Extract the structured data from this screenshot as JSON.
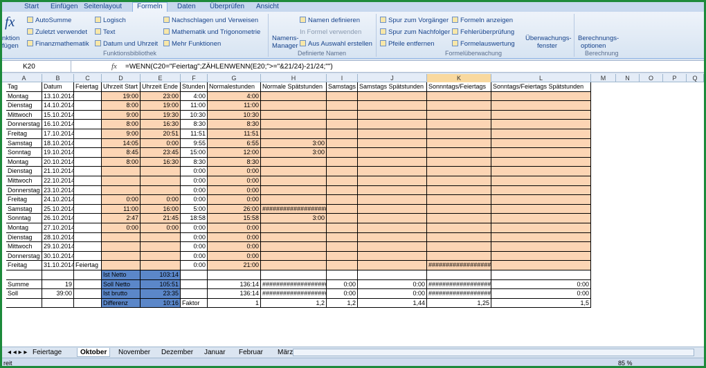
{
  "tabs": [
    "Start",
    "Einfügen",
    "Seitenlayout",
    "Formeln",
    "Daten",
    "Überprüfen",
    "Ansicht"
  ],
  "ribbon": {
    "fx_btn": "fx",
    "fx_label1": "nktion",
    "fx_label2": "fügen",
    "autosum": "AutoSumme",
    "recent": "Zuletzt verwendet",
    "finance": "Finanzmathematik",
    "logic": "Logisch",
    "text": "Text",
    "datetime": "Datum und Uhrzeit",
    "lookup": "Nachschlagen und Verweisen",
    "math": "Mathematik und Trigonometrie",
    "more": "Mehr Funktionen",
    "group1": "Funktionsbibliothek",
    "names_mgr": "Namens-",
    "names_mgr2": "Manager",
    "define": "Namen definieren",
    "in_formula": "In Formel verwenden",
    "from_sel": "Aus Auswahl erstellen",
    "group2": "Definierte Namen",
    "trace_prec": "Spur zum Vorgänger",
    "trace_dep": "Spur zum Nachfolger",
    "remove_arrows": "Pfeile entfernen",
    "show_formulas": "Formeln anzeigen",
    "error_check": "Fehlerüberprüfung",
    "evaluate": "Formelauswertung",
    "group3": "Formelüberwachung",
    "watch1": "Überwachungs-",
    "watch2": "fenster",
    "calc1": "Berechnungs-",
    "calc2": "optionen",
    "group4": "Berechnung"
  },
  "formula_bar": {
    "name": "K20",
    "fx": "fx",
    "formula": "=WENN(C20=\"Feiertag\";ZÄHLENWENN(E20;\">=\"&21/24)-21/24;\"\")"
  },
  "columns": [
    "A",
    "B",
    "C",
    "D",
    "E",
    "F",
    "G",
    "H",
    "I",
    "J",
    "K",
    "L",
    "M",
    "N",
    "O",
    "P",
    "Q"
  ],
  "headers": [
    "Tag",
    "Datum",
    "Feiertag",
    "Uhrzeit Start",
    "Uhrzeit Ende",
    "Stunden",
    "Normalestunden",
    "Normale Spätstunden",
    "Samstags",
    "Samstags Spätstunden",
    "Sonnntags/Feiertags",
    "Sonntags/Feiertags Spätstunden"
  ],
  "rows": [
    [
      "Montag",
      "13.10.2014",
      "",
      "19:00",
      "23:00",
      "4:00",
      "4:00",
      "",
      "",
      "",
      "",
      ""
    ],
    [
      "Dienstag",
      "14.10.2014",
      "",
      "8:00",
      "19:00",
      "11:00",
      "11:00",
      "",
      "",
      "",
      "",
      ""
    ],
    [
      "Mittwoch",
      "15.10.2014",
      "",
      "9:00",
      "19:30",
      "10:30",
      "10:30",
      "",
      "",
      "",
      "",
      ""
    ],
    [
      "Donnerstag",
      "16.10.2014",
      "",
      "8:00",
      "16:30",
      "8:30",
      "8:30",
      "",
      "",
      "",
      "",
      ""
    ],
    [
      "Freitag",
      "17.10.2014",
      "",
      "9:00",
      "20:51",
      "11:51",
      "11:51",
      "",
      "",
      "",
      "",
      ""
    ],
    [
      "Samstag",
      "18.10.2014",
      "",
      "14:05",
      "0:00",
      "9:55",
      "6:55",
      "3:00",
      "",
      "",
      "",
      ""
    ],
    [
      "Sonntag",
      "19.10.2014",
      "",
      "8:45",
      "23:45",
      "15:00",
      "12:00",
      "3:00",
      "",
      "",
      "",
      ""
    ],
    [
      "Montag",
      "20.10.2014",
      "",
      "8:00",
      "16:30",
      "8:30",
      "8:30",
      "",
      "",
      "",
      "",
      ""
    ],
    [
      "Dienstag",
      "21.10.2014",
      "",
      "",
      "",
      "0:00",
      "0:00",
      "",
      "",
      "",
      "",
      ""
    ],
    [
      "Mittwoch",
      "22.10.2014",
      "",
      "",
      "",
      "0:00",
      "0:00",
      "",
      "",
      "",
      "",
      ""
    ],
    [
      "Donnerstag",
      "23.10.2014",
      "",
      "",
      "",
      "0:00",
      "0:00",
      "",
      "",
      "",
      "",
      ""
    ],
    [
      "Freitag",
      "24.10.2014",
      "",
      "0:00",
      "0:00",
      "0:00",
      "0:00",
      "",
      "",
      "",
      "",
      ""
    ],
    [
      "Samstag",
      "25.10.2014",
      "",
      "11:00",
      "16:00",
      "5:00",
      "26:00",
      "####################",
      "",
      "",
      "",
      ""
    ],
    [
      "Sonntag",
      "26.10.2014",
      "",
      "2:47",
      "21:45",
      "18:58",
      "15:58",
      "3:00",
      "",
      "",
      "",
      ""
    ],
    [
      "Montag",
      "27.10.2014",
      "",
      "0:00",
      "0:00",
      "0:00",
      "0:00",
      "",
      "",
      "",
      "",
      ""
    ],
    [
      "Dienstag",
      "28.10.2014",
      "",
      "",
      "",
      "0:00",
      "0:00",
      "",
      "",
      "",
      "",
      ""
    ],
    [
      "Mittwoch",
      "29.10.2014",
      "",
      "",
      "",
      "0:00",
      "0:00",
      "",
      "",
      "",
      "",
      ""
    ],
    [
      "Donnerstag",
      "30.10.2014",
      "",
      "",
      "",
      "0:00",
      "0:00",
      "",
      "",
      "",
      "",
      ""
    ],
    [
      "Freitag",
      "31.10.2014",
      "Feiertag",
      "",
      "",
      "0:00",
      "21:00",
      "",
      "",
      "",
      "####################",
      ""
    ]
  ],
  "summary": [
    {
      "a": "",
      "b": "",
      "d": "Ist Netto",
      "e": "103:14",
      "f": "",
      "g": "",
      "h": "",
      "i": "",
      "j": "",
      "k": "",
      "l": ""
    },
    {
      "a": "Summe",
      "b": "19",
      "d": "Soll Netto",
      "e": "105:51",
      "f": "",
      "g": "136:14",
      "h": "####################",
      "i": "0:00",
      "j": "0:00",
      "k": "####################",
      "l": "0:00"
    },
    {
      "a": "Soll",
      "b": "39:00",
      "d": "Ist brutto",
      "e": "23:35",
      "f": "",
      "g": "136:14",
      "h": "####################",
      "i": "0:00",
      "j": "0:00",
      "k": "####################",
      "l": "0:00"
    },
    {
      "a": "",
      "b": "",
      "d": "Differenz",
      "e": "10:16",
      "f": "Faktor",
      "g": "1",
      "h": "1,2",
      "i": "1,2",
      "j": "1,44",
      "k": "1,25",
      "l": "1,5"
    }
  ],
  "sheets": [
    "Feiertage",
    "Oktober",
    "November",
    "Dezember",
    "Januar",
    "Februar",
    "März"
  ],
  "active_sheet": "Oktober",
  "status": {
    "left": "reit",
    "zoom": "85 %"
  }
}
